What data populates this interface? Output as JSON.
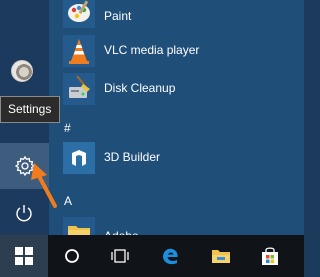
{
  "start_menu": {
    "settings_tooltip": "Settings",
    "apps": [
      {
        "label": "Paint",
        "icon": "paint-icon"
      },
      {
        "label": "VLC media player",
        "icon": "vlc-icon"
      },
      {
        "label": "Disk Cleanup",
        "icon": "disk-cleanup-icon"
      },
      {
        "label": "3D Builder",
        "icon": "3d-builder-icon"
      },
      {
        "label": "Adobe",
        "icon": "folder-icon"
      }
    ],
    "section_letters": [
      "#",
      "A"
    ],
    "left_rail_icons": [
      "user-avatar",
      "gear-icon",
      "power-icon"
    ]
  },
  "taskbar": {
    "icons": [
      "windows-start-icon",
      "cortana-circle-icon",
      "task-view-icon",
      "edge-icon",
      "file-explorer-icon",
      "store-icon"
    ]
  },
  "colors": {
    "list_background": "#1f4e79",
    "rail_background": "#1c3a5e",
    "taskbar": "#101418",
    "arrow": "#f07c1e",
    "edge_blue": "#1a8fe0"
  }
}
